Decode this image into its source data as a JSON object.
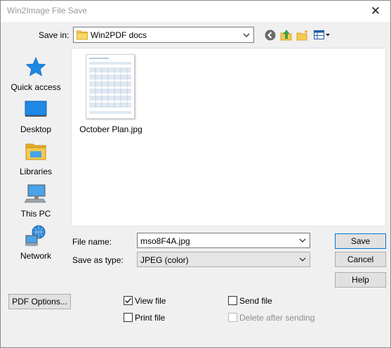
{
  "window": {
    "title": "Win2Image File Save",
    "close_glyph": "✕"
  },
  "save_in": {
    "label": "Save in:",
    "value": "Win2PDF docs"
  },
  "toolbar": {
    "icons": [
      "back-icon",
      "up-folder-icon",
      "new-folder-icon",
      "view-menu-icon"
    ]
  },
  "places": [
    {
      "name": "Quick access",
      "icon": "star-icon"
    },
    {
      "name": "Desktop",
      "icon": "desktop-icon"
    },
    {
      "name": "Libraries",
      "icon": "libraries-icon"
    },
    {
      "name": "This PC",
      "icon": "computer-icon"
    },
    {
      "name": "Network",
      "icon": "network-icon"
    }
  ],
  "files": [
    {
      "name": "October Plan.jpg"
    }
  ],
  "file_name": {
    "label": "File name:",
    "value": "mso8F4A.jpg"
  },
  "save_as_type": {
    "label": "Save as type:",
    "value": "JPEG (color)"
  },
  "buttons": {
    "save": "Save",
    "cancel": "Cancel",
    "help": "Help",
    "pdf_options": "PDF Options..."
  },
  "checkboxes": {
    "view_file": {
      "label": "View file",
      "checked": true
    },
    "print_file": {
      "label": "Print file",
      "checked": false
    },
    "send_file": {
      "label": "Send file",
      "checked": false
    },
    "delete_after_sending": {
      "label": "Delete after sending",
      "checked": false,
      "disabled": true
    }
  },
  "colors": {
    "accent": "#0078d7",
    "folder": "#f4c94f",
    "button_face": "#e1e1e1"
  }
}
